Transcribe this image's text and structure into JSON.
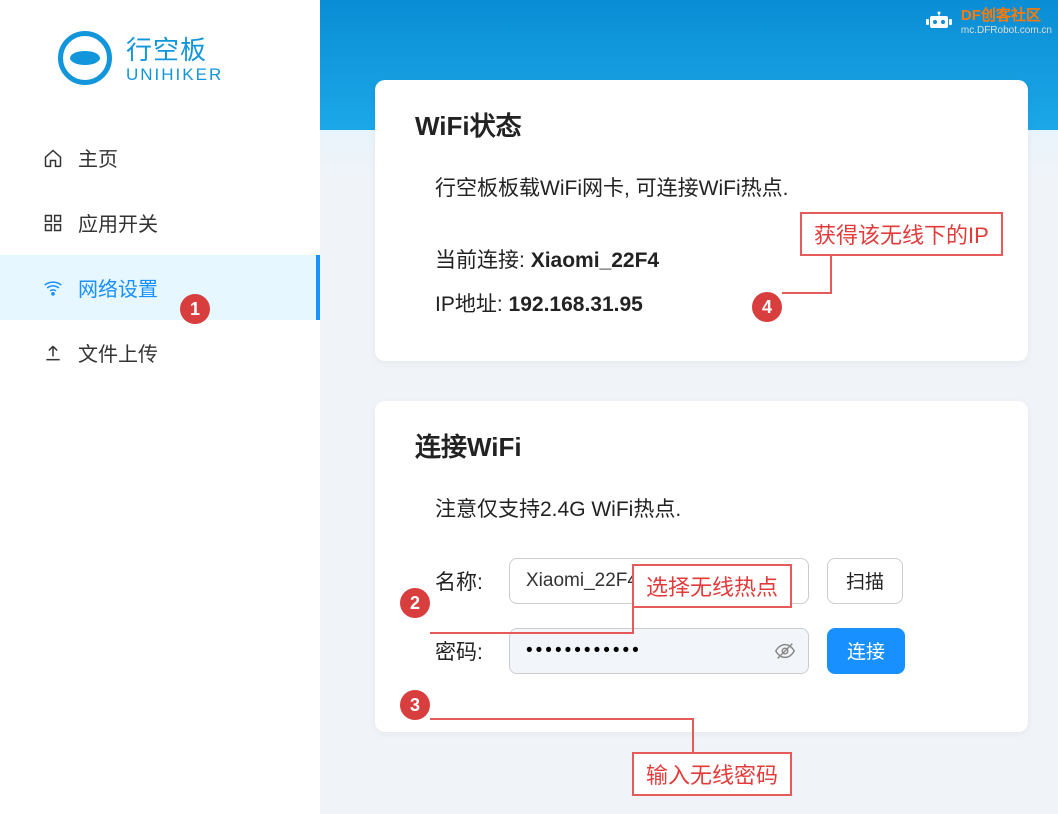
{
  "brand": {
    "cn": "行空板",
    "en": "UNIHIKER"
  },
  "watermark": {
    "title": "DF创客社区",
    "url": "mc.DFRobot.com.cn"
  },
  "sidebar": {
    "items": [
      {
        "icon": "home-icon",
        "label": "主页"
      },
      {
        "icon": "grid-icon",
        "label": "应用开关"
      },
      {
        "icon": "wifi-icon",
        "label": "网络设置"
      },
      {
        "icon": "upload-icon",
        "label": "文件上传"
      }
    ],
    "active_index": 2
  },
  "wifi_status": {
    "title": "WiFi状态",
    "desc": "行空板板载WiFi网卡, 可连接WiFi热点.",
    "current_label": "当前连接:",
    "current_value": "Xiaomi_22F4",
    "ip_label": "IP地址:",
    "ip_value": "192.168.31.95"
  },
  "connect_wifi": {
    "title": "连接WiFi",
    "note": "注意仅支持2.4G WiFi热点.",
    "name_label": "名称:",
    "selected_ssid": "Xiaomi_22F4",
    "scan_btn": "扫描",
    "password_label": "密码:",
    "password_mask": "••••••••••••",
    "connect_btn": "连接"
  },
  "annotations": {
    "a1": "1",
    "a2": "2",
    "a3": "3",
    "a4": "4",
    "tip_ip": "获得该无线下的IP",
    "tip_ssid": "选择无线热点",
    "tip_pwd": "输入无线密码"
  }
}
